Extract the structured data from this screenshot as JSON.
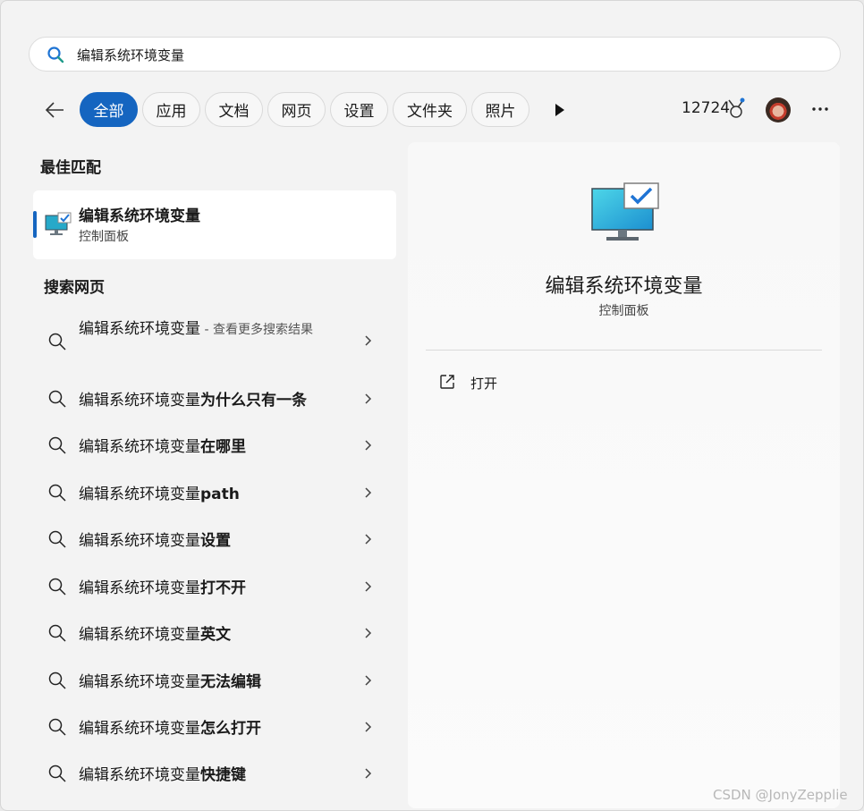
{
  "search": {
    "value": "编辑系统环境变量"
  },
  "filters": {
    "chips": [
      {
        "label": "全部",
        "active": true
      },
      {
        "label": "应用"
      },
      {
        "label": "文档"
      },
      {
        "label": "网页"
      },
      {
        "label": "设置"
      },
      {
        "label": "文件夹"
      },
      {
        "label": "照片"
      }
    ],
    "points": "12724"
  },
  "best_match": {
    "heading": "最佳匹配",
    "title": "编辑系统环境变量",
    "subtitle": "控制面板"
  },
  "web": {
    "heading": "搜索网页",
    "first": {
      "query": "编辑系统环境变量",
      "suffix": " - 查看更多搜索结果"
    },
    "items": [
      {
        "prefix": "编辑系统环境变量",
        "bold": "为什么只有一条"
      },
      {
        "prefix": "编辑系统环境变量",
        "bold": "在哪里"
      },
      {
        "prefix": "编辑系统环境变量",
        "bold": "path"
      },
      {
        "prefix": "编辑系统环境变量",
        "bold": "设置"
      },
      {
        "prefix": "编辑系统环境变量",
        "bold": "打不开"
      },
      {
        "prefix": "编辑系统环境变量",
        "bold": "英文"
      },
      {
        "prefix": "编辑系统环境变量",
        "bold": "无法编辑"
      },
      {
        "prefix": "编辑系统环境变量",
        "bold": "怎么打开"
      },
      {
        "prefix": "编辑系统环境变量",
        "bold": "快捷键"
      }
    ]
  },
  "detail": {
    "title": "编辑系统环境变量",
    "subtitle": "控制面板",
    "action_open": "打开"
  },
  "watermark": "CSDN @JonyZepplie",
  "colors": {
    "accent": "#1565c0",
    "background": "#f3f3f3"
  },
  "icons": {
    "search": "search-icon",
    "back": "back-arrow-icon",
    "play": "play-icon",
    "medal": "rewards-medal-icon",
    "more": "more-icon",
    "monitor": "control-panel-monitor-icon",
    "chevron": "chevron-right-icon",
    "open": "open-external-icon"
  }
}
